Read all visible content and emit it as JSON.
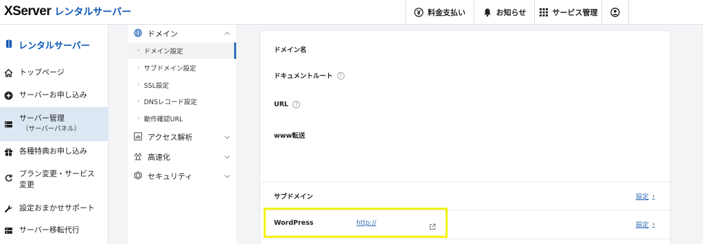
{
  "header": {
    "logo_main": "XServer",
    "logo_sub": "レンタルサーバー",
    "items": [
      {
        "label": "料金支払い",
        "icon": "yen-icon"
      },
      {
        "label": "お知らせ",
        "icon": "bell-icon"
      },
      {
        "label": "サービス管理",
        "icon": "grid-icon"
      }
    ],
    "account_icon": "user-circle-icon"
  },
  "sidebar": {
    "title": "レンタルサーバー",
    "items": [
      {
        "label": "トップページ",
        "icon": "home-icon"
      },
      {
        "label": "サーバーお申し込み",
        "icon": "plus-circle-icon"
      },
      {
        "label": "サーバー管理",
        "sub": "（サーバーパネル）",
        "icon": "server-icon",
        "active": true
      },
      {
        "label": "各種特典お申し込み",
        "icon": "gift-icon"
      },
      {
        "label": "プラン変更・サービス変更",
        "icon": "refresh-icon"
      },
      {
        "label": "設定おまかせサポート",
        "icon": "wrench-icon"
      },
      {
        "label": "サーバー移転代行",
        "icon": "truck-icon"
      }
    ]
  },
  "subnav": {
    "domain_head": "ドメイン",
    "domain_items": [
      "ドメイン設定",
      "サブドメイン設定",
      "SSL設定",
      "DNSレコード設定",
      "動作確認URL"
    ],
    "other_heads": [
      "アクセス解析",
      "高速化",
      "セキュリティ"
    ]
  },
  "main": {
    "rows": {
      "domain_name": "ドメイン名",
      "document_root": "ドキュメントルート",
      "url": "URL",
      "www": "www転送",
      "subdomain": "サブドメイン",
      "wordpress": "WordPress"
    },
    "setting_link": "設定",
    "wp_url": "http://",
    "help_glyph": "?"
  },
  "colors": {
    "brand_blue": "#0a57b6",
    "link_blue": "#2f6fb8",
    "highlight": "#f2f20e"
  }
}
